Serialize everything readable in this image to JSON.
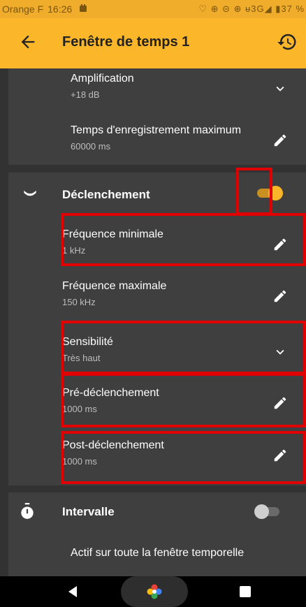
{
  "status_bar": {
    "carrier": "Orange F",
    "time": "16:26",
    "right_text": "♡ ⊕ ⊝ ⊕ ᵾ3G◢ ▮37 %"
  },
  "app_bar": {
    "title": "Fenêtre de temps 1",
    "back_icon": "arrow-back-icon",
    "restore_icon": "restore-icon"
  },
  "recording": {
    "items": [
      {
        "label": "Amplification",
        "value": "+18 dB",
        "icon": "chevron-down-icon"
      },
      {
        "label": "Temps d'enregistrement maximum",
        "value": "60000 ms",
        "icon": "pencil-icon"
      }
    ]
  },
  "trigger": {
    "title": "Déclenchement",
    "enabled": true,
    "items": [
      {
        "label": "Fréquence minimale",
        "value": "1 kHz",
        "icon": "pencil-icon"
      },
      {
        "label": "Fréquence maximale",
        "value": "150 kHz",
        "icon": "pencil-icon"
      },
      {
        "label": "Sensibilité",
        "value": "Très haut",
        "icon": "chevron-down-icon"
      },
      {
        "label": "Pré-déclenchement",
        "value": "1000 ms",
        "icon": "pencil-icon"
      },
      {
        "label": "Post-déclenchement",
        "value": "1000 ms",
        "icon": "pencil-icon"
      }
    ]
  },
  "interval": {
    "title": "Intervalle",
    "enabled": false,
    "description": "Actif sur toute la fenêtre temporelle"
  },
  "colors": {
    "accent": "#fbb62a",
    "background": "#323232",
    "card": "#3f3f3f",
    "highlight": "#e00000"
  }
}
